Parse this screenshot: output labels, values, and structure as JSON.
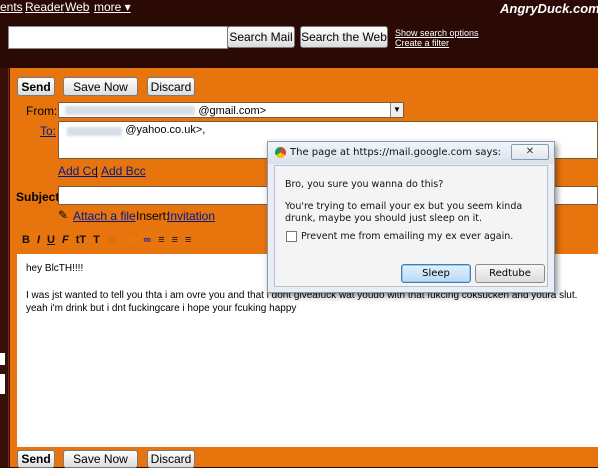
{
  "topnav": {
    "items": [
      "ents",
      "Reader",
      "Web",
      "more ▾"
    ]
  },
  "watermark": "AngryDuck.com",
  "search": {
    "mail_button": "Search Mail",
    "web_button": "Search the Web",
    "show_options": "Show search options",
    "create_filter": "Create a filter"
  },
  "toolbar": {
    "send": "Send",
    "save": "Save Now",
    "discard": "Discard"
  },
  "compose": {
    "from_label": "From:",
    "from_value": "@gmail.com>",
    "to_label": "To:",
    "to_value": "@yahoo.co.uk>,",
    "add_cc": "Add Cc",
    "add_bcc": "Add Bcc",
    "separator": "|",
    "subject_label": "Subject:",
    "attach": "Attach a file",
    "insert_label": "Insert:",
    "invitation": "Invitation",
    "body_lines": [
      "hey BlcTH!!!!",
      "",
      "I was jst wanted to tell you thta i am ovre you and that i dont giveafuck wat youdo with that fukcing coksucken and youra slut.",
      "yeah i'm drink but i dnt fuckingcare i hope your fcuking happy"
    ]
  },
  "format_toolbar": [
    "B",
    "I",
    "U",
    "F",
    "tT",
    "T",
    "☺",
    "☺",
    "∞",
    "≡",
    "≡",
    "≡"
  ],
  "dialog": {
    "title": "The page at https://mail.google.com says:",
    "line1": "Bro, you sure you wanna do this?",
    "line2": "You're trying to email your ex but you seem kinda drunk, maybe you should just sleep  on it.",
    "checkbox_label": "Prevent me from emailing my ex ever again.",
    "sleep": "Sleep",
    "redtube": "Redtube"
  }
}
